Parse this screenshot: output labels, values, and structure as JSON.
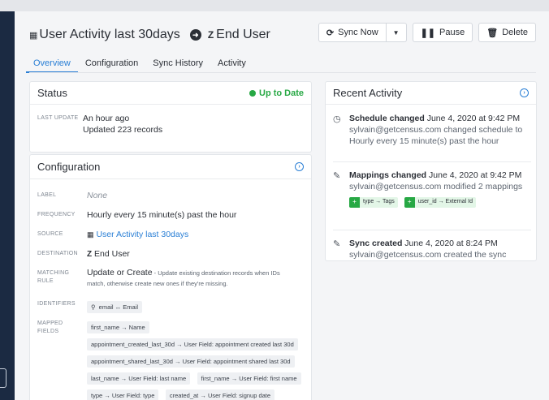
{
  "header": {
    "source_name": "User Activity last 30days",
    "destination_name": "End User"
  },
  "actions": {
    "sync_now": "Sync Now",
    "pause": "Pause",
    "delete": "Delete"
  },
  "tabs": [
    "Overview",
    "Configuration",
    "Sync History",
    "Activity"
  ],
  "status": {
    "title": "Status",
    "state": "Up to Date",
    "last_update_label": "LAST UPDATE",
    "last_update_value": "An hour ago",
    "records": "Updated 223 records"
  },
  "config": {
    "title": "Configuration",
    "label_label": "LABEL",
    "label_value": "None",
    "frequency_label": "FREQUENCY",
    "frequency_value": "Hourly every 15 minute(s) past the hour",
    "source_label": "SOURCE",
    "source_value": "User Activity last 30days",
    "destination_label": "DESTINATION",
    "destination_value": "End User",
    "matching_label_1": "MATCHING",
    "matching_label_2": "RULE",
    "matching_value": "Update or Create",
    "matching_desc": " - Update existing destination records when IDs match, otherwise create new ones if they're missing.",
    "identifiers_label": "IDENTIFIERS",
    "identifier_chip": "email ↔ Email",
    "mapped_label_1": "MAPPED",
    "mapped_label_2": "FIELDS",
    "mapped_fields": [
      "first_name → Name",
      "appointment_created_last_30d → User Field: appointment created last 30d",
      "appointment_shared_last_30d → User Field: appointment shared last 30d",
      "last_name → User Field: last name",
      "first_name → User Field: first name",
      "type → User Field: type",
      "created_at → User Field: signup date"
    ]
  },
  "recent": {
    "title": "Recent Activity",
    "items": [
      {
        "title": "Schedule changed",
        "time": " June 4, 2020 at 9:42 PM",
        "line1": "sylvain@getcensus.com changed schedule to",
        "line2": "Hourly every 15 minute(s) past the hour"
      },
      {
        "title": "Mappings changed",
        "time": " June 4, 2020 at 9:42 PM",
        "line1": "sylvain@getcensus.com modified 2 mappings",
        "tags": [
          "type → Tags",
          "user_id → External Id"
        ]
      },
      {
        "title": "Sync created",
        "time": " June 4, 2020 at 8:24 PM",
        "line1": "sylvain@getcensus.com created the sync"
      }
    ]
  },
  "icons": {
    "table": "table-icon",
    "arrow": "arrow-right-circle-icon",
    "zendesk": "zendesk-logo-icon",
    "sync": "sync-icon",
    "pause": "pause-icon",
    "trash": "trash-icon",
    "clock": "clock-icon",
    "edit": "edit-icon",
    "key": "key-icon"
  },
  "colors": {
    "accent": "#2a7fd5",
    "success": "#27a844",
    "sidebar": "#1b2a42"
  }
}
